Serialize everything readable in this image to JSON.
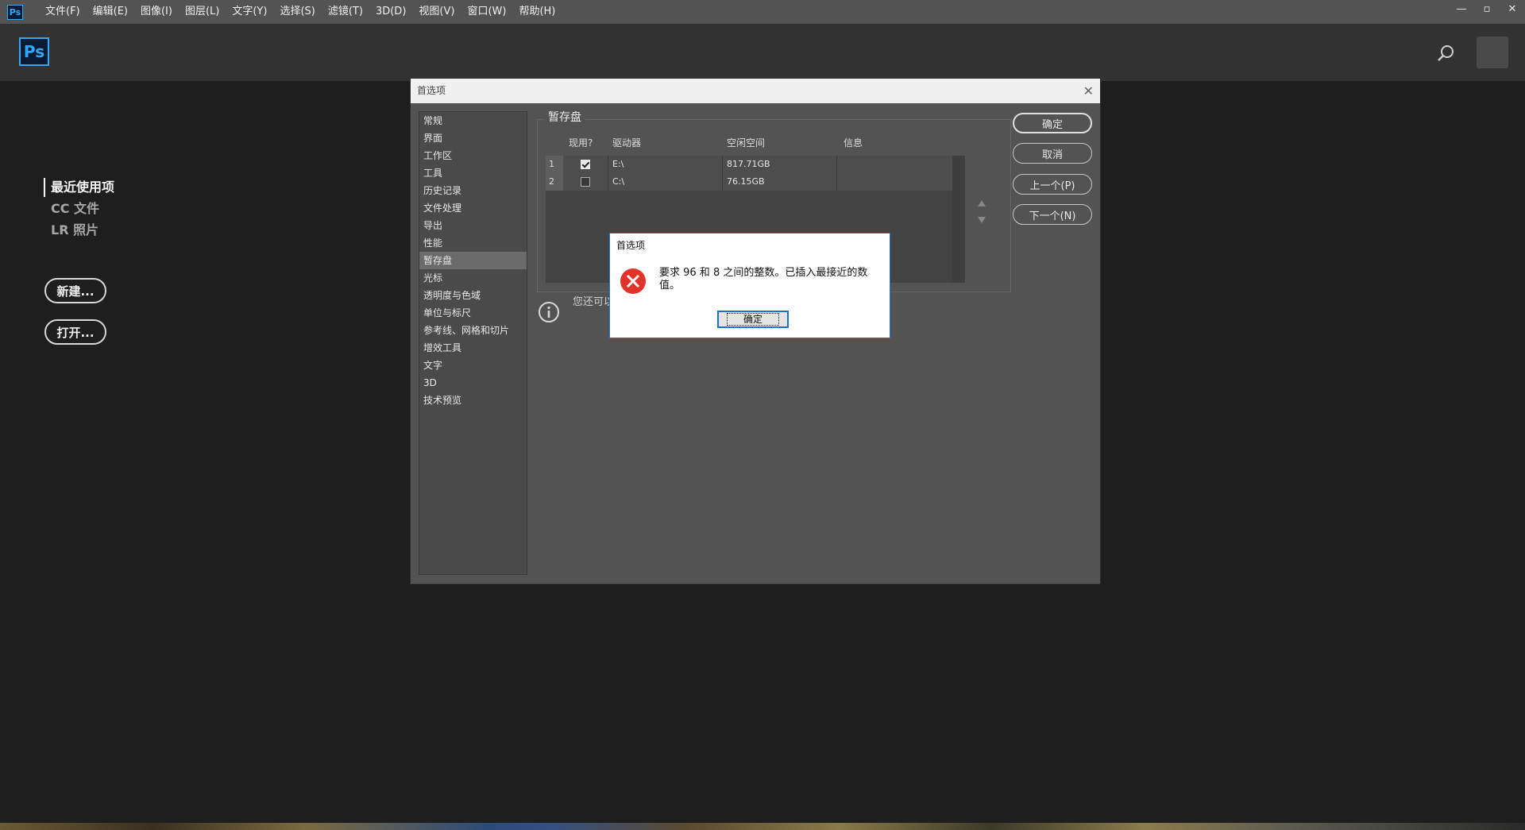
{
  "menubar": {
    "app_icon": "Ps",
    "items": [
      "文件(F)",
      "编辑(E)",
      "图像(I)",
      "图层(L)",
      "文字(Y)",
      "选择(S)",
      "滤镜(T)",
      "3D(D)",
      "视图(V)",
      "窗口(W)",
      "帮助(H)"
    ],
    "window_controls": [
      "—",
      "▫",
      "✕"
    ]
  },
  "header": {
    "logo": "Ps"
  },
  "start": {
    "recent": "最近使用项",
    "cc_files": "CC 文件",
    "lr_photos": "LR 照片",
    "new_button": "新建...",
    "open_button": "打开..."
  },
  "prefs": {
    "title": "首选项",
    "categories": [
      "常规",
      "界面",
      "工作区",
      "工具",
      "历史记录",
      "文件处理",
      "导出",
      "性能",
      "暂存盘",
      "光标",
      "透明度与色域",
      "单位与标尺",
      "参考线、网格和切片",
      "增效工具",
      "文字",
      "3D",
      "技术预览"
    ],
    "selected_category": "暂存盘",
    "group_title": "暂存盘",
    "columns": {
      "active": "现用?",
      "drive": "驱动器",
      "free": "空闲空间",
      "info": "信息"
    },
    "rows": [
      {
        "num": "1",
        "checked": true,
        "drive": "E:\\",
        "free": "817.71GB",
        "info": ""
      },
      {
        "num": "2",
        "checked": false,
        "drive": "C:\\",
        "free": "76.15GB",
        "info": ""
      }
    ],
    "info_text": "您还可以",
    "buttons": {
      "ok": "确定",
      "cancel": "取消",
      "prev": "上一个(P)",
      "next": "下一个(N)"
    }
  },
  "alert": {
    "title": "首选项",
    "message": "要求 96 和 8 之间的整数。已插入最接近的数值。",
    "ok": "确定"
  }
}
